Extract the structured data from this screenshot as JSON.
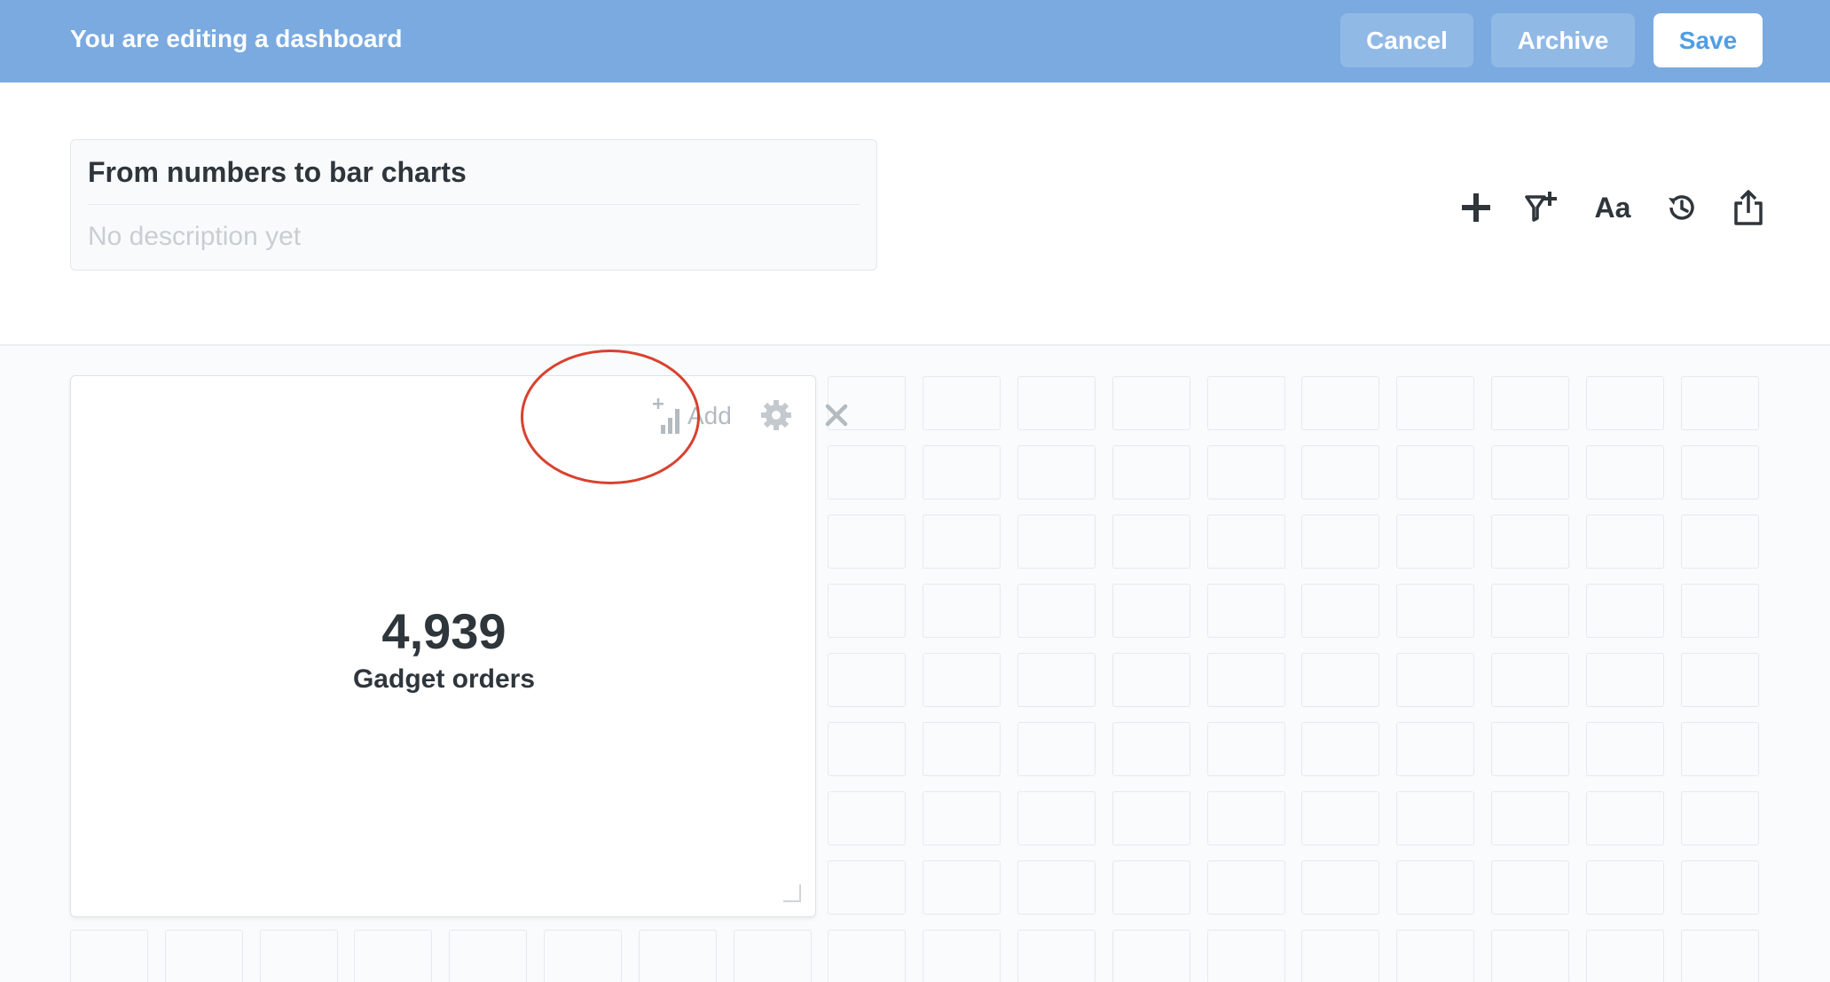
{
  "edit_bar": {
    "message": "You are editing a dashboard",
    "cancel_label": "Cancel",
    "archive_label": "Archive",
    "save_label": "Save",
    "background": "#7aaae0"
  },
  "dashboard": {
    "title": "From numbers to bar charts",
    "description_placeholder": "No description yet"
  },
  "toolbar": {
    "icons": [
      "add-icon",
      "filter-add-icon",
      "text-icon",
      "history-icon",
      "share-icon"
    ],
    "text_icon_label": "Aa"
  },
  "card": {
    "value": "4,939",
    "label": "Gadget orders",
    "add_label": "Add"
  },
  "colors": {
    "accent": "#509ee3",
    "highlight": "#d9412f"
  }
}
